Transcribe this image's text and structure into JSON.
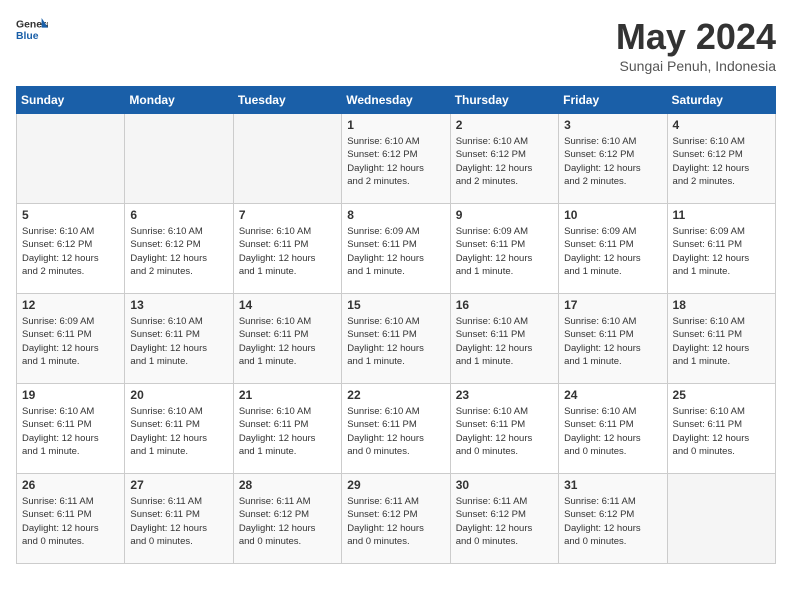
{
  "logo": {
    "general": "General",
    "blue": "Blue"
  },
  "title": {
    "month_year": "May 2024",
    "location": "Sungai Penuh, Indonesia"
  },
  "days_header": [
    "Sunday",
    "Monday",
    "Tuesday",
    "Wednesday",
    "Thursday",
    "Friday",
    "Saturday"
  ],
  "weeks": [
    [
      {
        "day": "",
        "info": ""
      },
      {
        "day": "",
        "info": ""
      },
      {
        "day": "",
        "info": ""
      },
      {
        "day": "1",
        "info": "Sunrise: 6:10 AM\nSunset: 6:12 PM\nDaylight: 12 hours\nand 2 minutes."
      },
      {
        "day": "2",
        "info": "Sunrise: 6:10 AM\nSunset: 6:12 PM\nDaylight: 12 hours\nand 2 minutes."
      },
      {
        "day": "3",
        "info": "Sunrise: 6:10 AM\nSunset: 6:12 PM\nDaylight: 12 hours\nand 2 minutes."
      },
      {
        "day": "4",
        "info": "Sunrise: 6:10 AM\nSunset: 6:12 PM\nDaylight: 12 hours\nand 2 minutes."
      }
    ],
    [
      {
        "day": "5",
        "info": "Sunrise: 6:10 AM\nSunset: 6:12 PM\nDaylight: 12 hours\nand 2 minutes."
      },
      {
        "day": "6",
        "info": "Sunrise: 6:10 AM\nSunset: 6:12 PM\nDaylight: 12 hours\nand 2 minutes."
      },
      {
        "day": "7",
        "info": "Sunrise: 6:10 AM\nSunset: 6:11 PM\nDaylight: 12 hours\nand 1 minute."
      },
      {
        "day": "8",
        "info": "Sunrise: 6:09 AM\nSunset: 6:11 PM\nDaylight: 12 hours\nand 1 minute."
      },
      {
        "day": "9",
        "info": "Sunrise: 6:09 AM\nSunset: 6:11 PM\nDaylight: 12 hours\nand 1 minute."
      },
      {
        "day": "10",
        "info": "Sunrise: 6:09 AM\nSunset: 6:11 PM\nDaylight: 12 hours\nand 1 minute."
      },
      {
        "day": "11",
        "info": "Sunrise: 6:09 AM\nSunset: 6:11 PM\nDaylight: 12 hours\nand 1 minute."
      }
    ],
    [
      {
        "day": "12",
        "info": "Sunrise: 6:09 AM\nSunset: 6:11 PM\nDaylight: 12 hours\nand 1 minute."
      },
      {
        "day": "13",
        "info": "Sunrise: 6:10 AM\nSunset: 6:11 PM\nDaylight: 12 hours\nand 1 minute."
      },
      {
        "day": "14",
        "info": "Sunrise: 6:10 AM\nSunset: 6:11 PM\nDaylight: 12 hours\nand 1 minute."
      },
      {
        "day": "15",
        "info": "Sunrise: 6:10 AM\nSunset: 6:11 PM\nDaylight: 12 hours\nand 1 minute."
      },
      {
        "day": "16",
        "info": "Sunrise: 6:10 AM\nSunset: 6:11 PM\nDaylight: 12 hours\nand 1 minute."
      },
      {
        "day": "17",
        "info": "Sunrise: 6:10 AM\nSunset: 6:11 PM\nDaylight: 12 hours\nand 1 minute."
      },
      {
        "day": "18",
        "info": "Sunrise: 6:10 AM\nSunset: 6:11 PM\nDaylight: 12 hours\nand 1 minute."
      }
    ],
    [
      {
        "day": "19",
        "info": "Sunrise: 6:10 AM\nSunset: 6:11 PM\nDaylight: 12 hours\nand 1 minute."
      },
      {
        "day": "20",
        "info": "Sunrise: 6:10 AM\nSunset: 6:11 PM\nDaylight: 12 hours\nand 1 minute."
      },
      {
        "day": "21",
        "info": "Sunrise: 6:10 AM\nSunset: 6:11 PM\nDaylight: 12 hours\nand 1 minute."
      },
      {
        "day": "22",
        "info": "Sunrise: 6:10 AM\nSunset: 6:11 PM\nDaylight: 12 hours\nand 0 minutes."
      },
      {
        "day": "23",
        "info": "Sunrise: 6:10 AM\nSunset: 6:11 PM\nDaylight: 12 hours\nand 0 minutes."
      },
      {
        "day": "24",
        "info": "Sunrise: 6:10 AM\nSunset: 6:11 PM\nDaylight: 12 hours\nand 0 minutes."
      },
      {
        "day": "25",
        "info": "Sunrise: 6:10 AM\nSunset: 6:11 PM\nDaylight: 12 hours\nand 0 minutes."
      }
    ],
    [
      {
        "day": "26",
        "info": "Sunrise: 6:11 AM\nSunset: 6:11 PM\nDaylight: 12 hours\nand 0 minutes."
      },
      {
        "day": "27",
        "info": "Sunrise: 6:11 AM\nSunset: 6:11 PM\nDaylight: 12 hours\nand 0 minutes."
      },
      {
        "day": "28",
        "info": "Sunrise: 6:11 AM\nSunset: 6:12 PM\nDaylight: 12 hours\nand 0 minutes."
      },
      {
        "day": "29",
        "info": "Sunrise: 6:11 AM\nSunset: 6:12 PM\nDaylight: 12 hours\nand 0 minutes."
      },
      {
        "day": "30",
        "info": "Sunrise: 6:11 AM\nSunset: 6:12 PM\nDaylight: 12 hours\nand 0 minutes."
      },
      {
        "day": "31",
        "info": "Sunrise: 6:11 AM\nSunset: 6:12 PM\nDaylight: 12 hours\nand 0 minutes."
      },
      {
        "day": "",
        "info": ""
      }
    ]
  ]
}
